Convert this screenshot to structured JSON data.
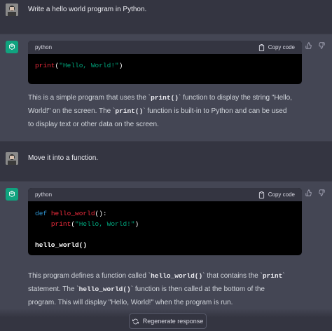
{
  "conversation": [
    {
      "role": "user",
      "text": "Write a hello world program in Python."
    },
    {
      "role": "assistant",
      "code_lang": "python",
      "copy_label": "Copy code",
      "code_lines": [
        {
          "fn": "print",
          "open": "(",
          "str": "\"Hello, World!\"",
          "close": ")"
        }
      ],
      "text_parts": [
        "This is a simple program that uses the `",
        "print()",
        "` function to display the string \"Hello, World!\" on the screen. The `",
        "print()",
        "` function is built-in to Python and can be used to display text or other data on the screen."
      ]
    },
    {
      "role": "user",
      "text": "Move it into a function."
    },
    {
      "role": "assistant",
      "code_lang": "python",
      "copy_label": "Copy code",
      "code": {
        "def_kw": "def",
        "def_name": "hello_world",
        "def_tail": "():",
        "indent_fn": "print",
        "indent_open": "(",
        "indent_str": "\"Hello, World!\"",
        "indent_close": ")",
        "call": "hello_world()"
      },
      "text_parts": [
        "This program defines a function called `",
        "hello_world()",
        "` that contains the `",
        "print",
        "` statement. The `",
        "hello_world()",
        "` function is then called at the bottom of the program. This will display \"Hello, World!\" when the program is run."
      ]
    }
  ],
  "regenerate_label": "Regenerate response",
  "colors": {
    "background": "#343541",
    "assistant_bg": "#444654",
    "brand_green": "#10a37f",
    "keyword": "#2e95d3",
    "function": "#f22c3d",
    "string": "#00a67d"
  },
  "icons": {
    "copy": "clipboard-icon",
    "thumbs_up": "thumbs-up-icon",
    "thumbs_down": "thumbs-down-icon",
    "regenerate": "refresh-icon",
    "assistant_avatar": "openai-logo-icon",
    "user_avatar": "user-photo-avatar"
  }
}
